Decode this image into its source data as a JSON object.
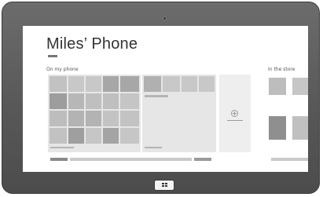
{
  "device": {
    "type": "windows tablet",
    "bezel_color": "#5f5f5f",
    "icons": {
      "camera": "camera-icon",
      "home": "windows-logo-icon"
    }
  },
  "start_screen": {
    "title": "Miles’ Phone",
    "sections": [
      {
        "label": "On my phone"
      },
      {
        "label": "In the store"
      }
    ],
    "add_group_icon": "add-icon"
  },
  "colors": {
    "tile_dark": "#9d9d9d",
    "tile_medium": "#bdbdbd",
    "tile_light": "#d0d0d0",
    "group_bg": "#e6e6e6",
    "scroll_thumb": "#8a8a8a"
  }
}
